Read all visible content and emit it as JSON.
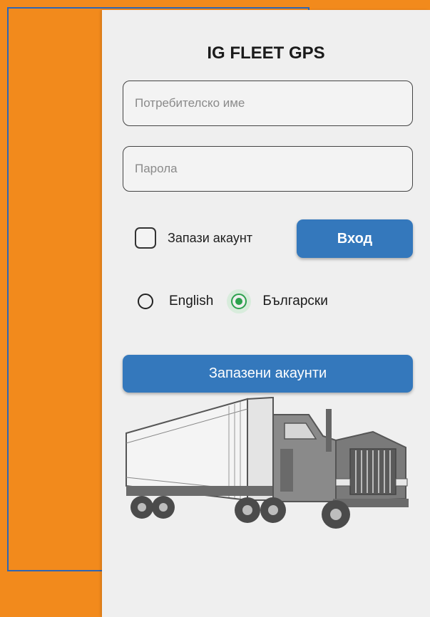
{
  "app": {
    "title": "IG FLEET GPS"
  },
  "form": {
    "username_placeholder": "Потребителско име",
    "username_value": "",
    "password_placeholder": "Парола",
    "password_value": "",
    "remember_label": "Запази акаунт",
    "remember_checked": false,
    "login_button_label": "Вход"
  },
  "language": {
    "options": [
      {
        "label": "English",
        "selected": false
      },
      {
        "label": "Български",
        "selected": true
      }
    ]
  },
  "saved_accounts_button_label": "Запазени акаунти",
  "illustration": {
    "icon": "truck-icon"
  },
  "colors": {
    "background": "#f28a1c",
    "panel": "#efefef",
    "primary_button": "#3478bc",
    "radio_selected": "#2ca14d",
    "frame_outline": "#2f66b3"
  }
}
